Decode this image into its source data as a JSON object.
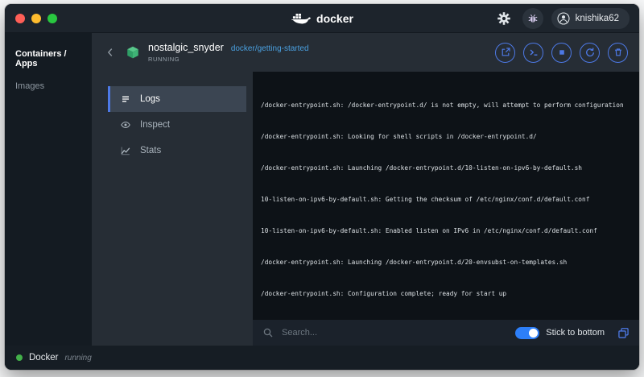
{
  "titlebar": {
    "app_name": "docker",
    "account": "knishika62",
    "window_buttons": [
      "close",
      "minimize",
      "zoom"
    ]
  },
  "sidebar": {
    "items": [
      {
        "label": "Containers / Apps",
        "active": true
      },
      {
        "label": "Images",
        "active": false
      }
    ]
  },
  "container": {
    "name": "nostalgic_snyder",
    "image": "docker/getting-started",
    "state": "RUNNING"
  },
  "tabs": [
    {
      "label": "Logs",
      "active": true
    },
    {
      "label": "Inspect",
      "active": false
    },
    {
      "label": "Stats",
      "active": false
    }
  ],
  "logs": {
    "lines": [
      "/docker-entrypoint.sh: /docker-entrypoint.d/ is not empty, will attempt to perform configuration",
      "/docker-entrypoint.sh: Looking for shell scripts in /docker-entrypoint.d/",
      "/docker-entrypoint.sh: Launching /docker-entrypoint.d/10-listen-on-ipv6-by-default.sh",
      "10-listen-on-ipv6-by-default.sh: Getting the checksum of /etc/nginx/conf.d/default.conf",
      "10-listen-on-ipv6-by-default.sh: Enabled listen on IPv6 in /etc/nginx/conf.d/default.conf",
      "/docker-entrypoint.sh: Launching /docker-entrypoint.d/20-envsubst-on-templates.sh",
      "/docker-entrypoint.sh: Configuration complete; ready for start up"
    ]
  },
  "log_footer": {
    "search_placeholder": "Search...",
    "stick_label": "Stick to bottom",
    "stick_on": true
  },
  "statusbar": {
    "app": "Docker",
    "status": "running"
  },
  "icons": {
    "titlebar": [
      "docker-whale-icon",
      "settings-gear-icon",
      "bug-icon",
      "user-icon"
    ],
    "container_header": [
      "back-chevron-icon",
      "container-cube-icon"
    ],
    "container_actions": [
      "open-in-browser-icon",
      "cli-icon",
      "stop-icon",
      "restart-icon",
      "delete-icon"
    ],
    "tabs": [
      "logs-icon",
      "inspect-eye-icon",
      "stats-chart-icon"
    ],
    "log_footer": [
      "search-icon",
      "copy-icon"
    ],
    "statusbar": [
      "running-dot-icon"
    ]
  },
  "colors": {
    "accent_blue": "#4d79e6",
    "link_blue": "#4aa0e0",
    "running_green": "#43b04a",
    "toggle_blue": "#2d7ff9",
    "log_bg": "#0d1217"
  }
}
